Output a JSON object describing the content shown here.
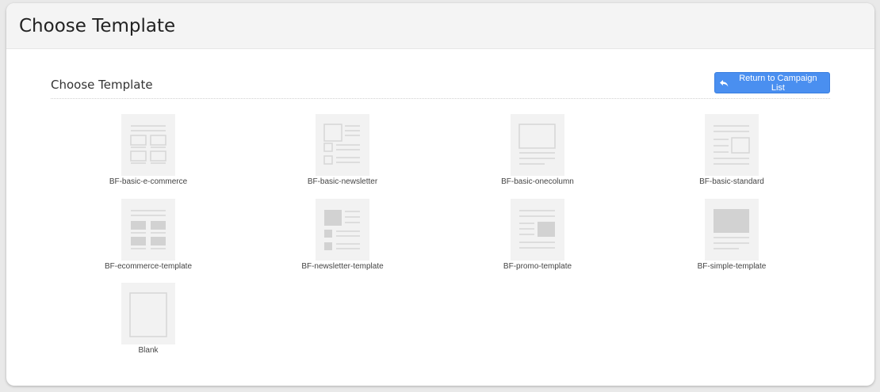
{
  "page": {
    "title": "Choose Template"
  },
  "section": {
    "title": "Choose Template",
    "return_button": {
      "label": "Return to Campaign List",
      "icon": "reply-arrow-icon"
    }
  },
  "colors": {
    "accent": "#4a8ff0",
    "thumb_bg": "#f2f2f2",
    "thumb_line": "#d9d9d9"
  },
  "templates": [
    {
      "label": "BF-basic-e-commerce",
      "icon": "e-commerce-layout-icon"
    },
    {
      "label": "BF-basic-newsletter",
      "icon": "newsletter-layout-icon"
    },
    {
      "label": "BF-basic-onecolumn",
      "icon": "onecolumn-layout-icon"
    },
    {
      "label": "BF-basic-standard",
      "icon": "standard-layout-icon"
    },
    {
      "label": "BF-ecommerce-template",
      "icon": "ecommerce-filled-layout-icon"
    },
    {
      "label": "BF-newsletter-template",
      "icon": "newsletter-filled-layout-icon"
    },
    {
      "label": "BF-promo-template",
      "icon": "promo-layout-icon"
    },
    {
      "label": "BF-simple-template",
      "icon": "simple-layout-icon"
    },
    {
      "label": "Blank",
      "icon": "blank-layout-icon"
    }
  ]
}
